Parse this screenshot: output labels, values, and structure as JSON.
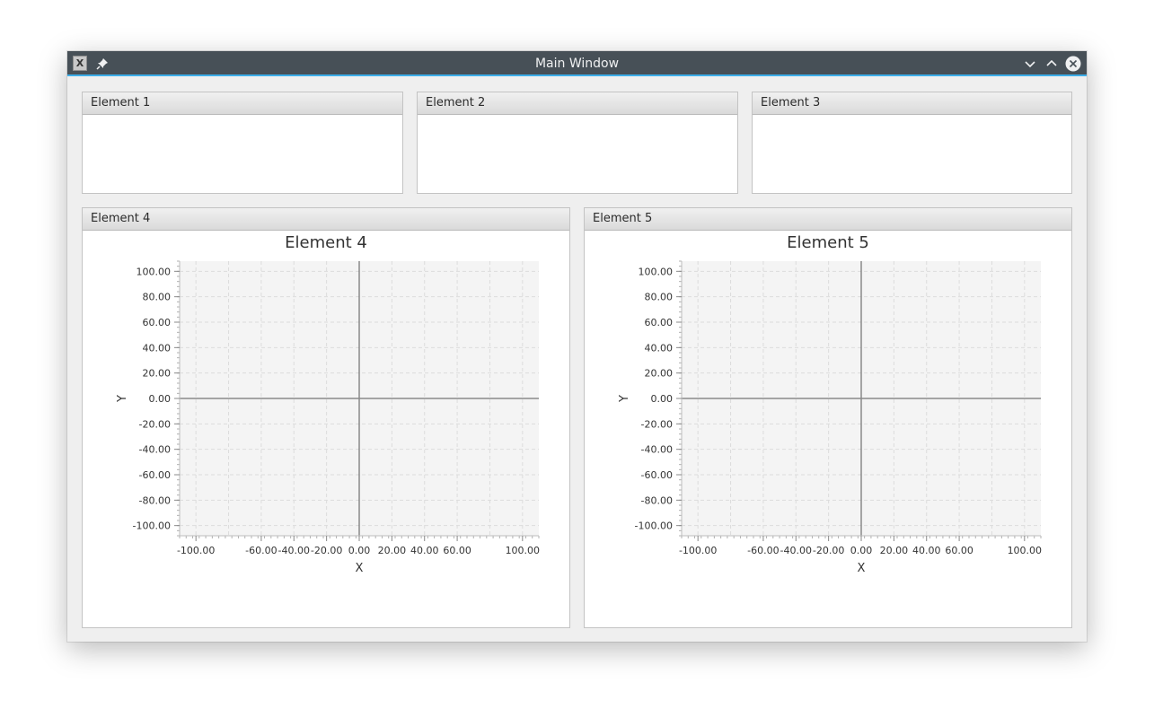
{
  "window": {
    "title": "Main Window"
  },
  "titlebar_icons": {
    "app": "x11-app-icon",
    "pin": "pin-icon",
    "minimize": "chevron-down-icon",
    "maximize": "chevron-up-icon",
    "close": "close-circle-icon"
  },
  "panels": [
    {
      "title": "Element 1"
    },
    {
      "title": "Element 2"
    },
    {
      "title": "Element 3"
    },
    {
      "title": "Element 4"
    },
    {
      "title": "Element 5"
    }
  ],
  "chart_data": [
    {
      "type": "scatter",
      "title": "Element 4",
      "xlabel": "X",
      "ylabel": "Y",
      "xlim": [
        -110,
        110
      ],
      "ylim": [
        -108,
        108
      ],
      "xticks": [
        "-100.00",
        "-60.00",
        "-40.00",
        "-20.00",
        "0.00",
        "20.00",
        "40.00",
        "60.00",
        "100.00"
      ],
      "yticks": [
        "100.00",
        "80.00",
        "60.00",
        "40.00",
        "20.00",
        "0.00",
        "-20.00",
        "-40.00",
        "-60.00",
        "-80.00",
        "-100.00"
      ],
      "grid": true,
      "series": []
    },
    {
      "type": "scatter",
      "title": "Element 5",
      "xlabel": "X",
      "ylabel": "Y",
      "xlim": [
        -110,
        110
      ],
      "ylim": [
        -108,
        108
      ],
      "xticks": [
        "-100.00",
        "-60.00",
        "-40.00",
        "-20.00",
        "0.00",
        "20.00",
        "40.00",
        "60.00",
        "100.00"
      ],
      "yticks": [
        "100.00",
        "80.00",
        "60.00",
        "40.00",
        "20.00",
        "0.00",
        "-20.00",
        "-40.00",
        "-60.00",
        "-80.00",
        "-100.00"
      ],
      "grid": true,
      "series": []
    }
  ],
  "colors": {
    "titlebar": "#475057",
    "titlebar_accent": "#3daee9",
    "window_bg": "#efefef",
    "plot_bg": "#f4f4f4",
    "grid": "#dcdcdc",
    "axis": "#555555"
  }
}
